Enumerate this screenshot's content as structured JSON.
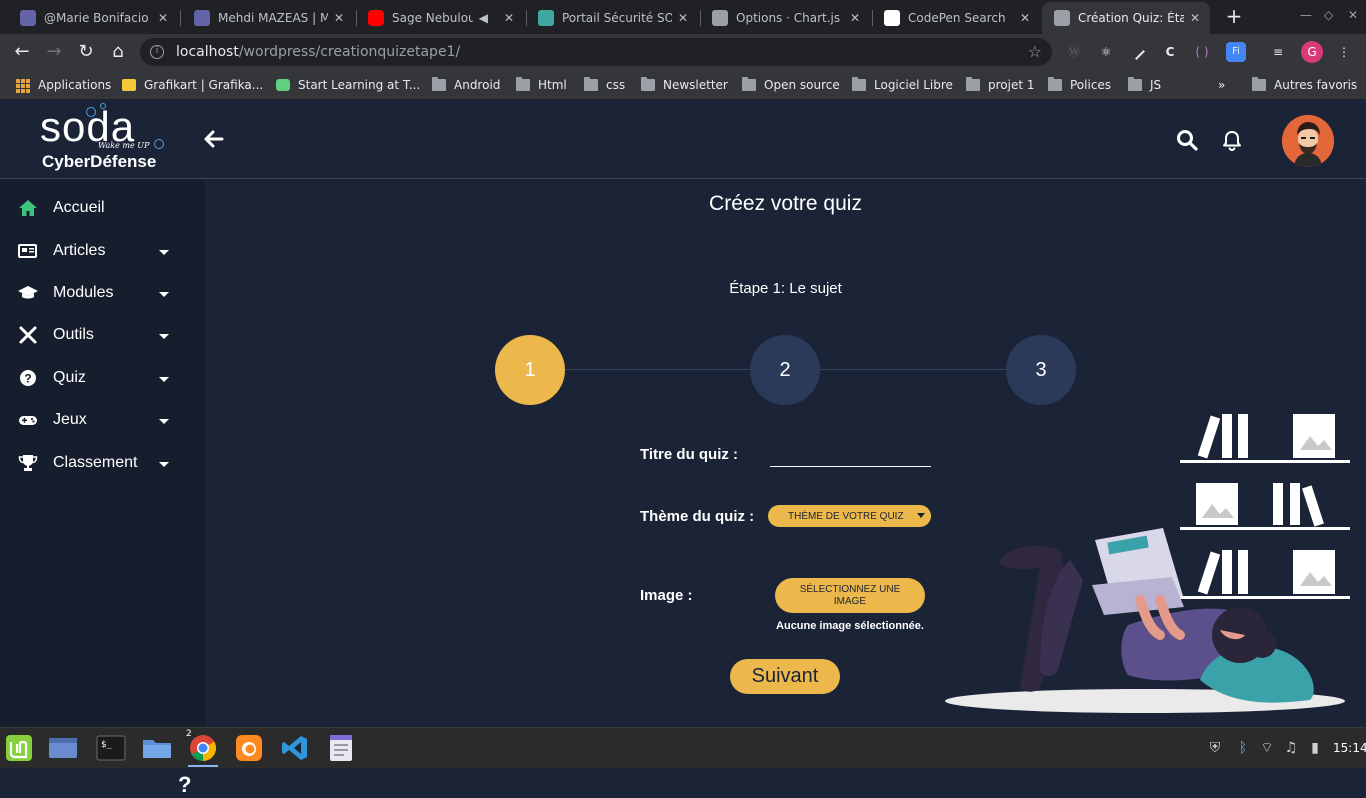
{
  "browser": {
    "tabs": [
      {
        "title": "@Marie Bonifacio -",
        "favicon_color": "#6264a7"
      },
      {
        "title": "Mehdi MAZEAS | M",
        "favicon_color": "#6264a7"
      },
      {
        "title": "Sage Nebulous",
        "favicon_color": "#ff0000"
      },
      {
        "title": "Portail Sécurité SO",
        "favicon_color": "#3ea8a1"
      },
      {
        "title": "Options · Chart.js d",
        "favicon_color": "#9aa0a6"
      },
      {
        "title": "CodePen Search",
        "favicon_color": "#ffffff"
      },
      {
        "title": "Création Quiz: Étap",
        "favicon_color": "#9aa0a6"
      }
    ],
    "url_host": "localhost",
    "url_path": "/wordpress/creationquizetape1/",
    "profile_initial": "G",
    "bookmarks": [
      "Applications",
      "Grafikart | Grafika...",
      "Start Learning at T...",
      "Android",
      "Html",
      "css",
      "Newsletter",
      "Open source",
      "Logiciel Libre",
      "projet 1",
      "Polices",
      "JS"
    ],
    "bookmarks_overflow": "»",
    "other_bookmarks": "Autres favoris"
  },
  "site": {
    "logo_text": "soda",
    "logo_tagline": "Wake me UP",
    "logo_subtitle": "CyberDéfense"
  },
  "sidebar": {
    "items": [
      {
        "label": "Accueil",
        "icon": "home-icon"
      },
      {
        "label": "Articles",
        "icon": "newspaper-icon"
      },
      {
        "label": "Modules",
        "icon": "graduation-cap-icon"
      },
      {
        "label": "Outils",
        "icon": "tools-icon"
      },
      {
        "label": "Quiz",
        "icon": "question-circle-icon"
      },
      {
        "label": "Jeux",
        "icon": "gamepad-icon"
      },
      {
        "label": "Classement",
        "icon": "trophy-icon"
      }
    ],
    "help": "?"
  },
  "main": {
    "title": "Créez votre quiz",
    "step_label": "Étape 1: Le sujet",
    "steps": [
      "1",
      "2",
      "3"
    ],
    "active_step": 1,
    "form": {
      "title_label": "Titre du quiz :",
      "title_value": "",
      "theme_label": "Thème du quiz :",
      "theme_select": "THÈME DE VOTRE QUIZ",
      "image_label": "Image :",
      "image_button": "SÉLECTIONNEZ UNE IMAGE",
      "image_status": "Aucune image sélectionnée.",
      "next_button": "Suivant"
    }
  },
  "taskbar": {
    "chrome_badge": "2",
    "clock": "15:14"
  },
  "colors": {
    "accent": "#ecb84b",
    "page_bg": "#1b2336",
    "sidebar_bg": "#161d2d",
    "step_inactive": "#2b3a58",
    "home_icon": "#3cc47c"
  }
}
